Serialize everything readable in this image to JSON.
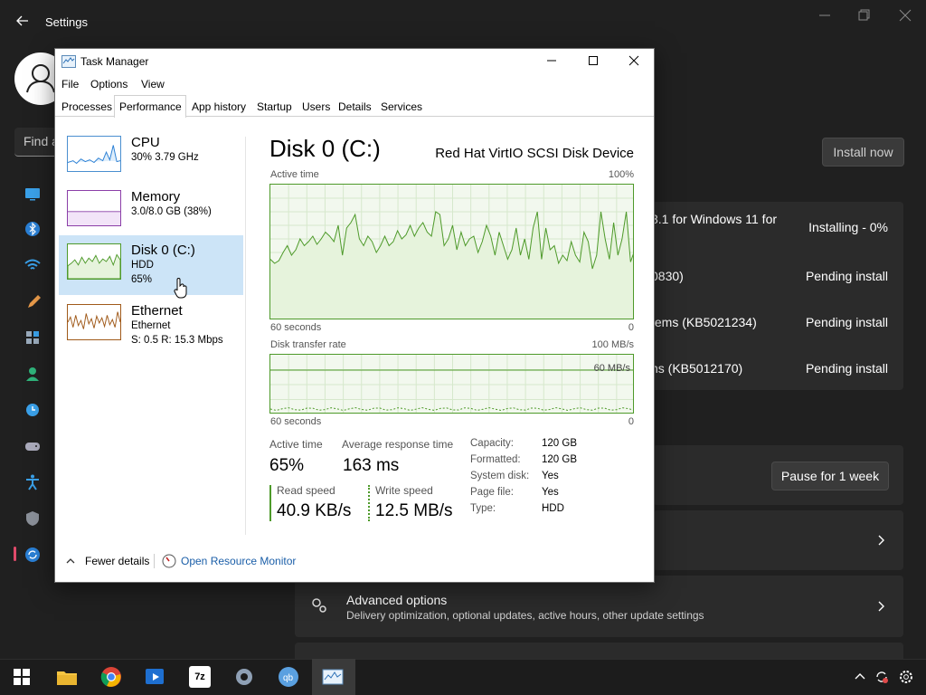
{
  "settings": {
    "title": "Settings",
    "find_text": "Find a",
    "install_now": "Install now",
    "updates": [
      {
        "name": "8.1 for Windows 11 for",
        "status": "Installing - 0%"
      },
      {
        "name": "0830)",
        "status": "Pending install"
      },
      {
        "name": "tems (KB5021234)",
        "status": "Pending install"
      },
      {
        "name": "ns (KB5012170)",
        "status": "Pending install"
      }
    ],
    "pause_label": "Pause for 1 week",
    "advanced": {
      "title": "Advanced options",
      "subtitle": "Delivery optimization, optional updates, active hours, other update settings"
    }
  },
  "task_manager": {
    "title": "Task Manager",
    "menu": [
      "File",
      "Options",
      "View"
    ],
    "tabs": [
      "Processes",
      "Performance",
      "App history",
      "Startup",
      "Users",
      "Details",
      "Services"
    ],
    "active_tab": "Performance",
    "sidebar": [
      {
        "name": "CPU",
        "line1": "30%  3.79 GHz",
        "line2": "",
        "line3": ""
      },
      {
        "name": "Memory",
        "line1": "3.0/8.0 GB (38%)",
        "line2": "",
        "line3": ""
      },
      {
        "name": "Disk 0 (C:)",
        "line1": "HDD",
        "line2": "65%",
        "line3": ""
      },
      {
        "name": "Ethernet",
        "line1": "Ethernet",
        "line2": "S: 0.5  R: 15.3 Mbps",
        "line3": ""
      }
    ],
    "detail": {
      "title": "Disk 0 (C:)",
      "device": "Red Hat VirtIO SCSI Disk Device",
      "active_time_label": "Active time",
      "active_time_max": "100%",
      "graph1_left": "60 seconds",
      "graph1_right": "0",
      "transfer_label": "Disk transfer rate",
      "transfer_max": "100 MB/s",
      "transfer_mid": "60 MB/s",
      "graph2_left": "60 seconds",
      "graph2_right": "0",
      "stats": {
        "active_time_label": "Active time",
        "active_time": "65%",
        "avg_resp_label": "Average response time",
        "avg_resp": "163 ms",
        "read_label": "Read speed",
        "read": "40.9 KB/s",
        "write_label": "Write speed",
        "write": "12.5 MB/s"
      },
      "props": [
        {
          "k": "Capacity:",
          "v": "120 GB"
        },
        {
          "k": "Formatted:",
          "v": "120 GB"
        },
        {
          "k": "System disk:",
          "v": "Yes"
        },
        {
          "k": "Page file:",
          "v": "Yes"
        },
        {
          "k": "Type:",
          "v": "HDD"
        }
      ]
    },
    "footer": {
      "fewer": "Fewer details",
      "monitor": "Open Resource Monitor"
    },
    "active_series": [
      45,
      42,
      44,
      50,
      55,
      48,
      52,
      60,
      55,
      58,
      62,
      56,
      60,
      65,
      62,
      58,
      70,
      48,
      68,
      72,
      78,
      60,
      55,
      62,
      58,
      50,
      55,
      62,
      55,
      58,
      66,
      60,
      63,
      70,
      62,
      68,
      72,
      65,
      62,
      80,
      78,
      55,
      60,
      70,
      52,
      65,
      55,
      60,
      62,
      50,
      58,
      70,
      62,
      48,
      65,
      55,
      45,
      52,
      68,
      48,
      60,
      45,
      68,
      80,
      45,
      68,
      52,
      55,
      42,
      48,
      44,
      58,
      48,
      43,
      65,
      58,
      38,
      48,
      80,
      60,
      45,
      72,
      48,
      60,
      80,
      43,
      52
    ]
  },
  "colors": {
    "accent": "#4e9a2a",
    "selection": "#cce4f7",
    "link": "#1a5ea8"
  }
}
